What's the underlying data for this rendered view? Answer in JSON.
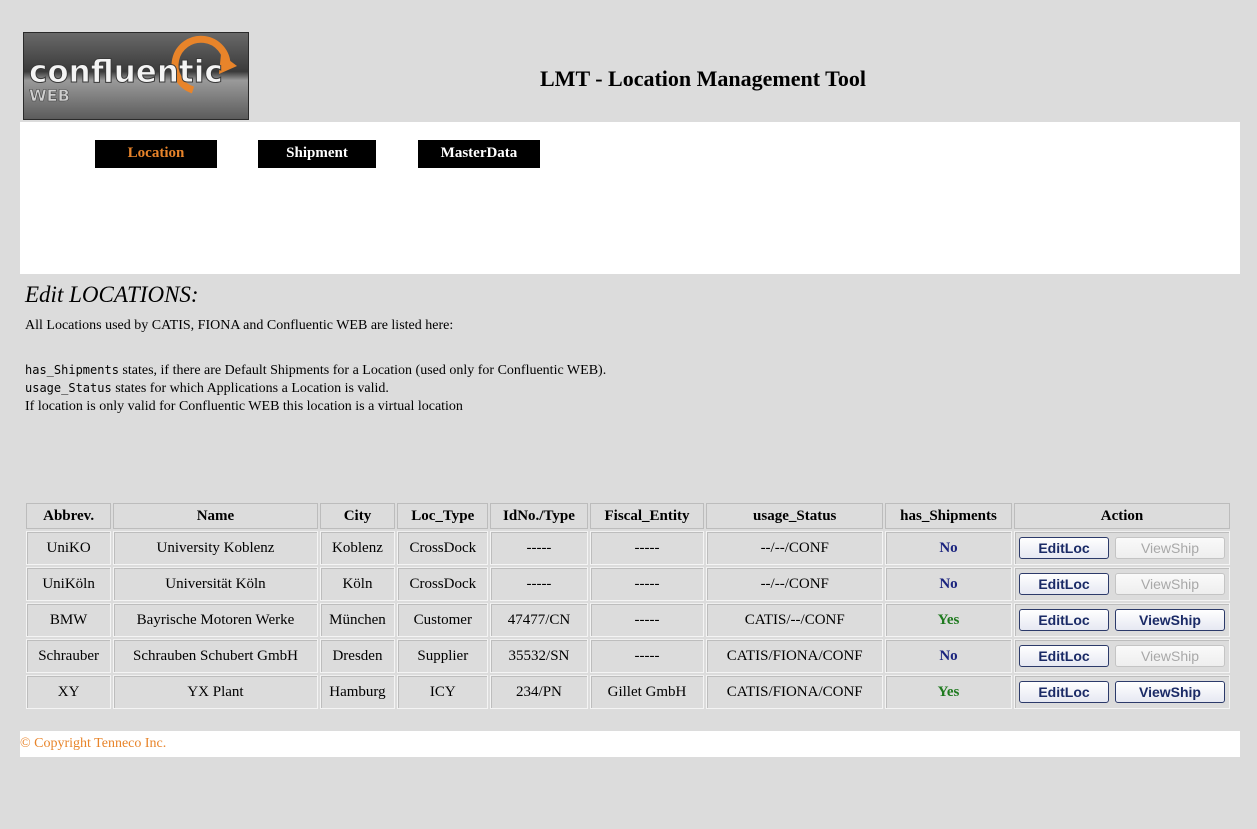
{
  "header": {
    "logo_text": "confluentic",
    "logo_sub": "WEB",
    "title": "LMT - Location Management Tool"
  },
  "nav": {
    "items": [
      {
        "label": "Location",
        "active": true
      },
      {
        "label": "Shipment",
        "active": false
      },
      {
        "label": "MasterData",
        "active": false
      }
    ]
  },
  "main": {
    "section_title": "Edit LOCATIONS:",
    "intro": "All Locations used by CATIS, FIONA and Confluentic WEB are listed here:",
    "note1_code": "has_Shipments",
    "note1_text": " states, if there are Default Shipments for a Location (used only for Confluentic WEB).",
    "note2_code": "usage_Status",
    "note2_text": " states for which Applications a Location is valid.",
    "note3": "If location is only valid for Confluentic WEB this location is a virtual location"
  },
  "table": {
    "columns": [
      "Abbrev.",
      "Name",
      "City",
      "Loc_Type",
      "IdNo./Type",
      "Fiscal_Entity",
      "usage_Status",
      "has_Shipments",
      "Action"
    ],
    "rows": [
      {
        "abbrev": "UniKO",
        "name": "University Koblenz",
        "city": "Koblenz",
        "loc_type": "CrossDock",
        "idno": "-----",
        "fiscal": "-----",
        "usage": "--/--/CONF",
        "has_shipments": "No",
        "edit_label": "EditLoc",
        "view_label": "ViewShip",
        "view_enabled": false
      },
      {
        "abbrev": "UniKöln",
        "name": "Universität Köln",
        "city": "Köln",
        "loc_type": "CrossDock",
        "idno": "-----",
        "fiscal": "-----",
        "usage": "--/--/CONF",
        "has_shipments": "No",
        "edit_label": "EditLoc",
        "view_label": "ViewShip",
        "view_enabled": false
      },
      {
        "abbrev": "BMW",
        "name": "Bayrische Motoren Werke",
        "city": "München",
        "loc_type": "Customer",
        "idno": "47477/CN",
        "fiscal": "-----",
        "usage": "CATIS/--/CONF",
        "has_shipments": "Yes",
        "edit_label": "EditLoc",
        "view_label": "ViewShip",
        "view_enabled": true
      },
      {
        "abbrev": "Schrauber",
        "name": "Schrauben Schubert GmbH",
        "city": "Dresden",
        "loc_type": "Supplier",
        "idno": "35532/SN",
        "fiscal": "-----",
        "usage": "CATIS/FIONA/CONF",
        "has_shipments": "No",
        "edit_label": "EditLoc",
        "view_label": "ViewShip",
        "view_enabled": false
      },
      {
        "abbrev": "XY",
        "name": "YX Plant",
        "city": "Hamburg",
        "loc_type": "ICY",
        "idno": "234/PN",
        "fiscal": "Gillet GmbH",
        "usage": "CATIS/FIONA/CONF",
        "has_shipments": "Yes",
        "edit_label": "EditLoc",
        "view_label": "ViewShip",
        "view_enabled": true
      }
    ]
  },
  "footer": {
    "copyright": "© Copyright Tenneco Inc."
  },
  "colors": {
    "accent": "#e8842a",
    "no": "#1a237e",
    "yes": "#1f7a1f",
    "background": "#dcdcdc"
  }
}
